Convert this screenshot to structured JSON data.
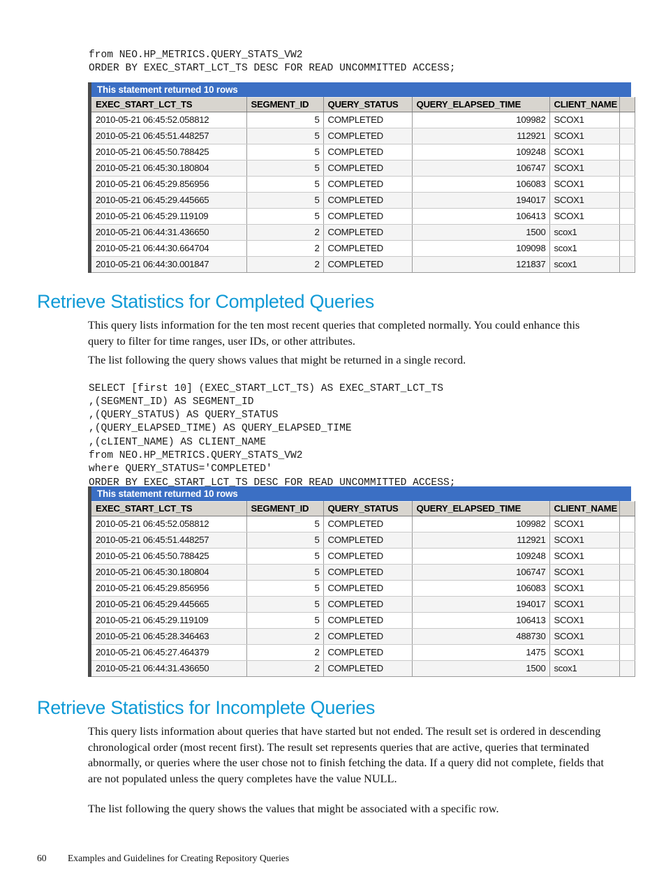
{
  "page": {
    "number": "60",
    "footer_title": "Examples and Guidelines for Creating Repository Queries"
  },
  "code_top": "from NEO.HP_METRICS.QUERY_STATS_VW2\nORDER BY EXEC_START_LCT_TS DESC FOR READ UNCOMMITTED ACCESS;",
  "grid_top": {
    "titlebar": "This statement returned 10 rows",
    "columns": [
      "EXEC_START_LCT_TS",
      "SEGMENT_ID",
      "QUERY_STATUS",
      "QUERY_ELAPSED_TIME",
      "CLIENT_NAME",
      ""
    ],
    "rows": [
      [
        "2010-05-21 06:45:52.058812",
        "5",
        "COMPLETED",
        "109982",
        "SCOX1",
        ""
      ],
      [
        "2010-05-21 06:45:51.448257",
        "5",
        "COMPLETED",
        "112921",
        "SCOX1",
        ""
      ],
      [
        "2010-05-21 06:45:50.788425",
        "5",
        "COMPLETED",
        "109248",
        "SCOX1",
        ""
      ],
      [
        "2010-05-21 06:45:30.180804",
        "5",
        "COMPLETED",
        "106747",
        "SCOX1",
        ""
      ],
      [
        "2010-05-21 06:45:29.856956",
        "5",
        "COMPLETED",
        "106083",
        "SCOX1",
        ""
      ],
      [
        "2010-05-21 06:45:29.445665",
        "5",
        "COMPLETED",
        "194017",
        "SCOX1",
        ""
      ],
      [
        "2010-05-21 06:45:29.119109",
        "5",
        "COMPLETED",
        "106413",
        "SCOX1",
        ""
      ],
      [
        "2010-05-21 06:44:31.436650",
        "2",
        "COMPLETED",
        "1500",
        "scox1",
        ""
      ],
      [
        "2010-05-21 06:44:30.664704",
        "2",
        "COMPLETED",
        "109098",
        "scox1",
        ""
      ],
      [
        "2010-05-21 06:44:30.001847",
        "2",
        "COMPLETED",
        "121837",
        "scox1",
        ""
      ]
    ]
  },
  "section_completed": {
    "heading": "Retrieve Statistics for Completed Queries",
    "para1": "This query lists information for the ten most recent queries that completed normally. You could enhance this query to filter for time ranges, user IDs, or other attributes.",
    "para2": "The list following the query shows values that might be returned in a single record."
  },
  "code_middle": "SELECT [first 10] (EXEC_START_LCT_TS) AS EXEC_START_LCT_TS\n,(SEGMENT_ID) AS SEGMENT_ID\n,(QUERY_STATUS) AS QUERY_STATUS\n,(QUERY_ELAPSED_TIME) AS QUERY_ELAPSED_TIME\n,(cLIENT_NAME) AS CLIENT_NAME\nfrom NEO.HP_METRICS.QUERY_STATS_VW2\nwhere QUERY_STATUS='COMPLETED'\nORDER BY EXEC_START_LCT_TS DESC FOR READ UNCOMMITTED ACCESS;",
  "grid_bottom": {
    "titlebar": "This statement returned 10 rows",
    "columns": [
      "EXEC_START_LCT_TS",
      "SEGMENT_ID",
      "QUERY_STATUS",
      "QUERY_ELAPSED_TIME",
      "CLIENT_NAME",
      ""
    ],
    "rows": [
      [
        "2010-05-21 06:45:52.058812",
        "5",
        "COMPLETED",
        "109982",
        "SCOX1",
        ""
      ],
      [
        "2010-05-21 06:45:51.448257",
        "5",
        "COMPLETED",
        "112921",
        "SCOX1",
        ""
      ],
      [
        "2010-05-21 06:45:50.788425",
        "5",
        "COMPLETED",
        "109248",
        "SCOX1",
        ""
      ],
      [
        "2010-05-21 06:45:30.180804",
        "5",
        "COMPLETED",
        "106747",
        "SCOX1",
        ""
      ],
      [
        "2010-05-21 06:45:29.856956",
        "5",
        "COMPLETED",
        "106083",
        "SCOX1",
        ""
      ],
      [
        "2010-05-21 06:45:29.445665",
        "5",
        "COMPLETED",
        "194017",
        "SCOX1",
        ""
      ],
      [
        "2010-05-21 06:45:29.119109",
        "5",
        "COMPLETED",
        "106413",
        "SCOX1",
        ""
      ],
      [
        "2010-05-21 06:45:28.346463",
        "2",
        "COMPLETED",
        "488730",
        "SCOX1",
        ""
      ],
      [
        "2010-05-21 06:45:27.464379",
        "2",
        "COMPLETED",
        "1475",
        "SCOX1",
        ""
      ],
      [
        "2010-05-21 06:44:31.436650",
        "2",
        "COMPLETED",
        "1500",
        "scox1",
        ""
      ]
    ]
  },
  "section_incomplete": {
    "heading": "Retrieve Statistics for Incomplete Queries",
    "para1": "This query lists information about queries that have started but not ended. The result set is ordered in descending chronological order (most recent first). The result set represents queries that are active, queries that terminated abnormally, or queries where the user chose not to finish fetching the data. If a query did not complete, fields that are not populated unless the query completes have the value NULL.",
    "para2": "The list following the query shows the values that might be associated with a specific row."
  },
  "colors": {
    "grid_titlebar_bg": "#3b6fc4",
    "grid_header_bg": "#d8d5cf",
    "heading_blue": "#0f9ad6",
    "row_alt_bg": "#f4f4f4"
  }
}
